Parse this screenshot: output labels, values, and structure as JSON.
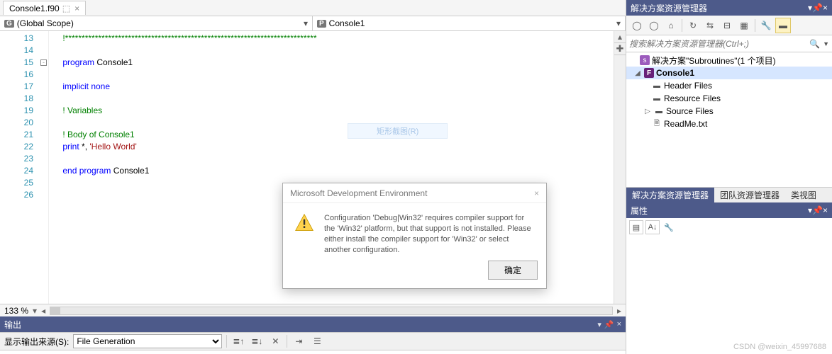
{
  "editor": {
    "tab_name": "Console1.f90",
    "scope_left_badge": "G",
    "scope_left": "(Global Scope)",
    "scope_right_badge": "P",
    "scope_right": "Console1",
    "zoom": "133 %",
    "lines": [
      {
        "n": 13,
        "cls": "c-green",
        "txt": "!****************************************************************************"
      },
      {
        "n": 14,
        "cls": "",
        "txt": ""
      },
      {
        "n": 15,
        "cls": "",
        "txt": "<span class=\"c-blue\">program</span> Console1"
      },
      {
        "n": 16,
        "cls": "",
        "txt": ""
      },
      {
        "n": 17,
        "cls": "c-blue",
        "txt": "implicit none"
      },
      {
        "n": 18,
        "cls": "",
        "txt": ""
      },
      {
        "n": 19,
        "cls": "c-green",
        "txt": "! Variables"
      },
      {
        "n": 20,
        "cls": "",
        "txt": ""
      },
      {
        "n": 21,
        "cls": "c-green",
        "txt": "! Body of Console1"
      },
      {
        "n": 22,
        "cls": "",
        "txt": "<span class=\"c-blue\">print</span> *, <span class=\"c-red\">'Hello World'</span>"
      },
      {
        "n": 23,
        "cls": "",
        "txt": ""
      },
      {
        "n": 24,
        "cls": "",
        "txt": "<span class=\"c-blue\">end program</span> Console1"
      },
      {
        "n": 25,
        "cls": "",
        "txt": ""
      },
      {
        "n": 26,
        "cls": "",
        "txt": ""
      }
    ],
    "ghost_hint": "矩形截图(R)"
  },
  "output": {
    "title": "输出",
    "source_label": "显示输出来源(S):",
    "source_value": "File Generation"
  },
  "explorer": {
    "title": "解决方案资源管理器",
    "search_placeholder": "搜索解决方案资源管理器(Ctrl+;)",
    "solution": "解决方案\"Subroutines\"(1 个项目)",
    "project": "Console1",
    "folders": [
      "Header Files",
      "Resource Files",
      "Source Files"
    ],
    "file": "ReadMe.txt",
    "tabs": [
      "解决方案资源管理器",
      "团队资源管理器",
      "类视图"
    ]
  },
  "properties": {
    "title": "属性"
  },
  "dialog": {
    "title": "Microsoft Development Environment",
    "body": "Configuration 'Debug|Win32' requires compiler support for the 'Win32' platform, but that support is not installed. Please either install the compiler support for 'Win32' or select another configuration.",
    "ok": "确定"
  },
  "watermark": "CSDN @weixin_45997688"
}
